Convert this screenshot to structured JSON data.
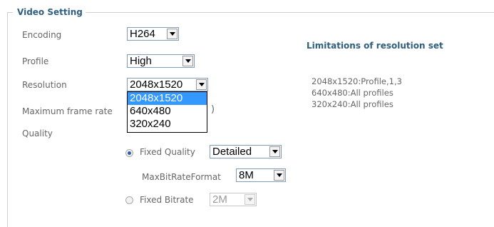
{
  "section": {
    "legend": "Video Setting"
  },
  "encoding": {
    "label": "Encoding",
    "value": "H264"
  },
  "profile": {
    "label": "Profile",
    "value": "High"
  },
  "resolution": {
    "label": "Resolution",
    "value": "2048x1520",
    "options": [
      "2048x1520",
      "640x480",
      "320x240"
    ]
  },
  "max_frame_rate": {
    "label": "Maximum frame rate",
    "value_partial": ")"
  },
  "quality": {
    "label": "Quality",
    "fixed_quality": {
      "label": "Fixed Quality",
      "value": "Detailed"
    },
    "max_bitrate_format": {
      "label": "MaxBitRateFormat",
      "value": "8M"
    },
    "fixed_bitrate": {
      "label": "Fixed Bitrate",
      "value": "2M"
    }
  },
  "limitations": {
    "title": "Limitations of resolution set",
    "lines": [
      "2048x1520:Profile,1,3",
      "640x480:All profiles",
      "320x240:All profiles"
    ]
  },
  "colors": {
    "accent": "#2f5f7f",
    "selection": "#3399ff",
    "border": "#7f9db9"
  }
}
